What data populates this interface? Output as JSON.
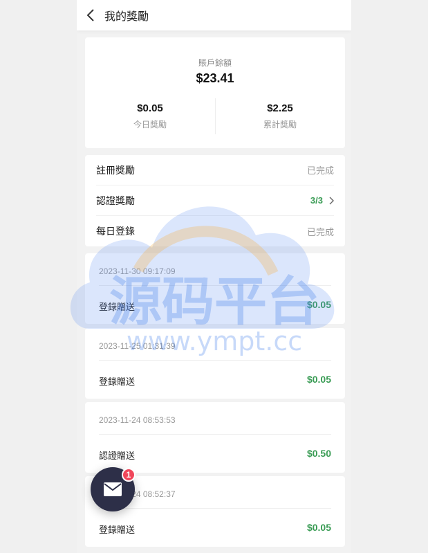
{
  "header": {
    "title": "我的獎勵"
  },
  "balance": {
    "label": "賬戶餘額",
    "value": "$23.41",
    "today": {
      "value": "$0.05",
      "label": "今日獎勵"
    },
    "total": {
      "value": "$2.25",
      "label": "累計獎勵"
    }
  },
  "tasks": [
    {
      "name": "註冊獎勵",
      "status": "已完成"
    },
    {
      "name": "認證獎勵",
      "status": "3/3"
    },
    {
      "name": "每日登錄",
      "status": "已完成"
    }
  ],
  "records": [
    {
      "date": "2023-11-30 09:17:09",
      "type": "登錄贈送",
      "amount": "$0.05"
    },
    {
      "date": "2023-11-25 01:31:39",
      "type": "登錄贈送",
      "amount": "$0.05"
    },
    {
      "date": "2023-11-24 08:53:53",
      "type": "認證贈送",
      "amount": "$0.50"
    },
    {
      "date": "2023-11-24 08:52:37",
      "type": "登錄贈送",
      "amount": "$0.05"
    }
  ],
  "watermark": {
    "text": "源码平台",
    "url": "www.ympt.cc"
  },
  "fab": {
    "icon": "mail-icon",
    "badge": "1"
  },
  "colors": {
    "accent_green": "#3a9c55",
    "fab_bg": "#2d2f48",
    "badge_red": "#f0465a"
  }
}
